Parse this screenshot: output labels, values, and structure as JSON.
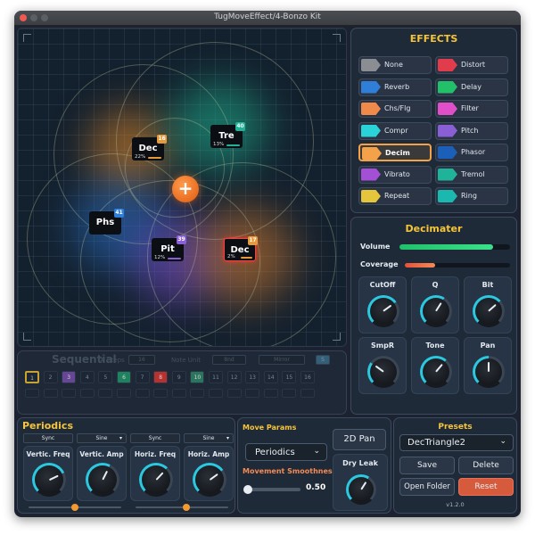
{
  "window": {
    "title": "TugMoveEffect/4-Bonzo Kit"
  },
  "xy_pad": {
    "nodes": [
      {
        "name": "Dec",
        "badge": "16",
        "badge_color": "#e79a3a",
        "pct": "22%",
        "bar_color": "#e79a3a"
      },
      {
        "name": "Tre",
        "badge": "40",
        "badge_color": "#1fb39a",
        "pct": "13%",
        "bar_color": "#1fb39a"
      },
      {
        "name": "Phs",
        "badge": "41",
        "badge_color": "#2f7fd8",
        "pct": "",
        "bar_color": ""
      },
      {
        "name": "Pit",
        "badge": "39",
        "badge_color": "#8a5fd6",
        "pct": "12%",
        "bar_color": "#8a5fd6"
      },
      {
        "name": "Dec",
        "badge": "17",
        "badge_color": "#e79a3a",
        "pct": "2%",
        "bar_color": "#e79a3a"
      }
    ],
    "center_symbol": "+"
  },
  "effects": {
    "title": "EFFECTS",
    "items": [
      {
        "label": "None",
        "color": "#8a8d92"
      },
      {
        "label": "Distort",
        "color": "#e03c4c"
      },
      {
        "label": "Reverb",
        "color": "#2f7fd8"
      },
      {
        "label": "Delay",
        "color": "#23c06a"
      },
      {
        "label": "Chs/Flg",
        "color": "#f08a4a"
      },
      {
        "label": "Filter",
        "color": "#e04fc7"
      },
      {
        "label": "Compr",
        "color": "#2ad3d8"
      },
      {
        "label": "Pitch",
        "color": "#8a5fd6"
      },
      {
        "label": "Decim",
        "color": "#f3a24a"
      },
      {
        "label": "Phasor",
        "color": "#1b5fb8"
      },
      {
        "label": "Vibrato",
        "color": "#a34fd6"
      },
      {
        "label": "Tremol",
        "color": "#1fb39a"
      },
      {
        "label": "Repeat",
        "color": "#e4c53b"
      },
      {
        "label": "Ring",
        "color": "#1bb8b0"
      }
    ],
    "selected": "Decim"
  },
  "decimater": {
    "title": "Decimater",
    "volume_label": "Volume",
    "volume_level": 0.85,
    "coverage_label": "Coverage",
    "coverage_level": 0.29,
    "knobs": [
      {
        "label": "CutOff",
        "level": 0.7
      },
      {
        "label": "Q",
        "level": 0.62
      },
      {
        "label": "Bit",
        "level": 0.68
      },
      {
        "label": "SmpR",
        "level": 0.3
      },
      {
        "label": "Tone",
        "level": 0.65
      },
      {
        "label": "Pan",
        "level": 0.5
      }
    ]
  },
  "sequential": {
    "title": "Sequential",
    "steps_label": "# Steps",
    "steps_value": "16",
    "note_unit_label": "Note Unit",
    "note_unit_value": "8nd",
    "mirror_label": "Mirror",
    "toggle_label": "S",
    "step_numbers": [
      "1",
      "2",
      "3",
      "4",
      "5",
      "6",
      "7",
      "8",
      "9",
      "10",
      "11",
      "12",
      "13",
      "14",
      "15",
      "16"
    ]
  },
  "periodics": {
    "title": "Periodics",
    "dropdowns": [
      "Sync",
      "Sine",
      "Sync",
      "Sine"
    ],
    "knobs": [
      {
        "label": "Vertic. Freq",
        "level": 0.74
      },
      {
        "label": "Vertic. Amp",
        "level": 0.6
      },
      {
        "label": "Horiz. Freq",
        "level": 0.66
      },
      {
        "label": "Horiz. Amp",
        "level": 0.7
      }
    ],
    "sliders": [
      0.5,
      0.55
    ]
  },
  "move_params": {
    "title": "Move Params",
    "mode_value": "Periodics",
    "pan_button": "2D Pan",
    "smoothness_label": "Movement Smoothness:",
    "smoothness_value": "0.50",
    "dry_leak_label": "Dry Leak",
    "dry_leak_level": 0.62
  },
  "presets": {
    "title": "Presets",
    "selected": "DecTriangle2",
    "save": "Save",
    "delete": "Delete",
    "open_folder": "Open Folder",
    "reset": "Reset",
    "version": "v1.2.0"
  }
}
